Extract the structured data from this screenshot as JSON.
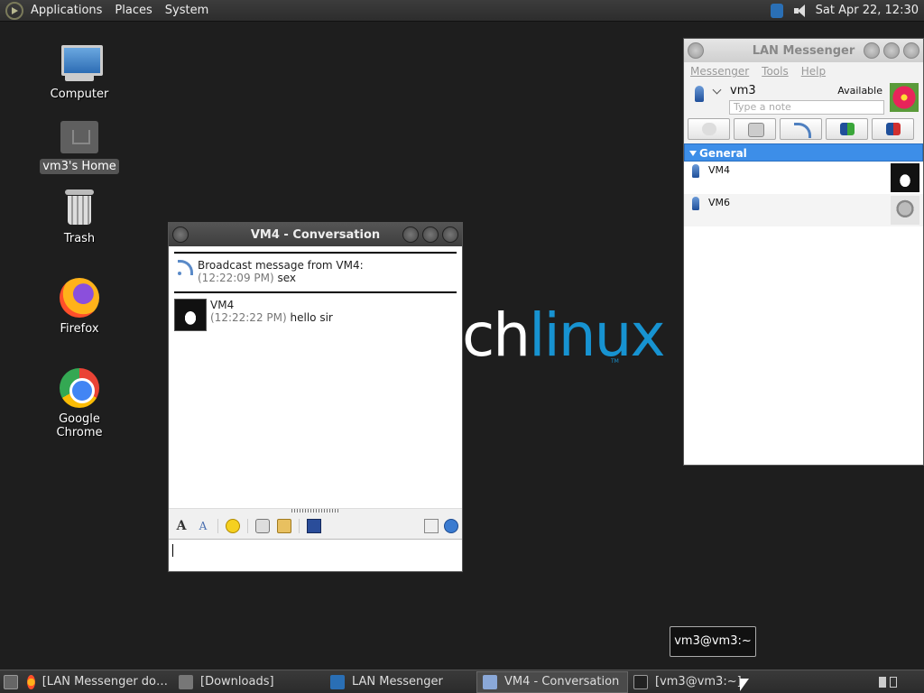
{
  "top_panel": {
    "menus": [
      "Applications",
      "Places",
      "System"
    ],
    "clock": "Sat Apr 22, 12:30"
  },
  "desktop": {
    "icons": [
      {
        "label": "Computer"
      },
      {
        "label": "vm3's Home"
      },
      {
        "label": "Trash"
      },
      {
        "label": "Firefox"
      },
      {
        "label": "Google Chrome"
      }
    ],
    "wallpaper_text_white": "ch",
    "wallpaper_text_blue": "linux",
    "wallpaper_tm": "TM"
  },
  "conversation": {
    "title": "VM4 - Conversation",
    "broadcast_header": "Broadcast message from VM4:",
    "broadcast_time": "(12:22:09 PM)",
    "broadcast_text": "sex",
    "msg_sender": "VM4",
    "msg_time": "(12:22:22 PM)",
    "msg_text": "hello sir"
  },
  "lan_messenger": {
    "title": "LAN Messenger",
    "menus": [
      "Messenger",
      "Tools",
      "Help"
    ],
    "user_name": "vm3",
    "status": "Available",
    "note_placeholder": "Type a note",
    "group": "General",
    "contacts": [
      {
        "name": "VM4"
      },
      {
        "name": "VM6"
      }
    ]
  },
  "tooltip": "vm3@vm3:~",
  "taskbar": {
    "tasks": [
      {
        "label": "[LAN Messenger do…"
      },
      {
        "label": "[Downloads]"
      },
      {
        "label": "LAN Messenger"
      },
      {
        "label": "VM4 - Conversation"
      },
      {
        "label": "[vm3@vm3:~]"
      }
    ]
  },
  "colors": {
    "group_header": "#3d8ee8",
    "arch_blue": "#1793d1"
  }
}
